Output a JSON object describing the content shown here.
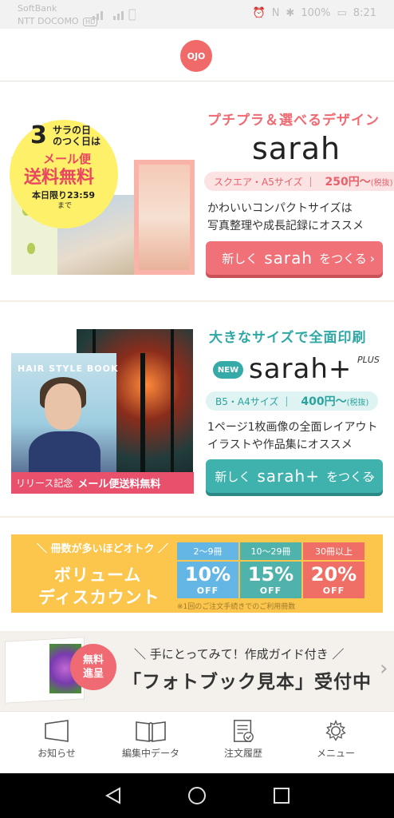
{
  "status_bar": {
    "carrier_1": "SoftBank",
    "carrier_2": "NTT DOCOMO",
    "hd": "HD",
    "battery": "100%",
    "time": "8:21"
  },
  "header": {
    "logo_text": "OJO"
  },
  "sarah": {
    "tagline": "プチプラ＆選べるデザイン",
    "wordmark": "sarah",
    "size": "スクエア・A5サイズ",
    "price": "250円〜",
    "tax": "(税抜)",
    "desc_1": "かわいいコンパクトサイズは",
    "desc_2": "写真整理や成長記録にオススメ",
    "cta_prefix": "新しく",
    "cta_brand": "sarah",
    "cta_suffix": "をつくる",
    "promo": {
      "day": "3",
      "day_sub_1": "サラの日",
      "day_sub_2": "のつく日は",
      "mail": "メール便",
      "free": "送料無料",
      "deadline": "本日限り23:59",
      "until": "まで"
    }
  },
  "sarah_plus": {
    "tagline": "大きなサイズで全面印刷",
    "new_badge": "NEW",
    "wordmark": "sarah+",
    "plus_label": "PLUS",
    "size": "B5・A4サイズ",
    "price": "400円〜",
    "tax": "(税抜)",
    "desc_1": "1ページ1枚画像の全面レイアウト",
    "desc_2": "イラストや作品集にオススメ",
    "cta_prefix": "新しく",
    "cta_brand": "sarah+",
    "cta_suffix": "をつくる",
    "promo": {
      "book_title": "HAIR STYLE BOOK",
      "release_1": "リリース記念",
      "release_2": "メール便送料無料"
    }
  },
  "discount": {
    "header": "冊数が多いほどオトク",
    "line_1": "ボリューム",
    "line_2": "ディスカウント",
    "tiers": [
      {
        "range": "2〜9冊",
        "pct": "10%",
        "off": "OFF"
      },
      {
        "range": "10〜29冊",
        "pct": "15%",
        "off": "OFF"
      },
      {
        "range": "30冊以上",
        "pct": "20%",
        "off": "OFF"
      }
    ],
    "note": "※1回のご注文手続きでのご利用冊数"
  },
  "sample": {
    "badge_1": "無料",
    "badge_2": "進呈",
    "line_1": "＼ 手にとってみて！作成ガイド付き ／",
    "line_2": "「フォトブック見本」受付中"
  },
  "bottom_nav": [
    {
      "label": "お知らせ",
      "icon": "megaphone-icon"
    },
    {
      "label": "編集中データ",
      "icon": "open-book-icon"
    },
    {
      "label": "注文履歴",
      "icon": "order-document-icon"
    },
    {
      "label": "メニュー",
      "icon": "gear-icon"
    }
  ],
  "colors": {
    "accent_pink": "#f07178",
    "accent_teal": "#3fb2ad",
    "discount_yellow": "#fcc54b"
  }
}
